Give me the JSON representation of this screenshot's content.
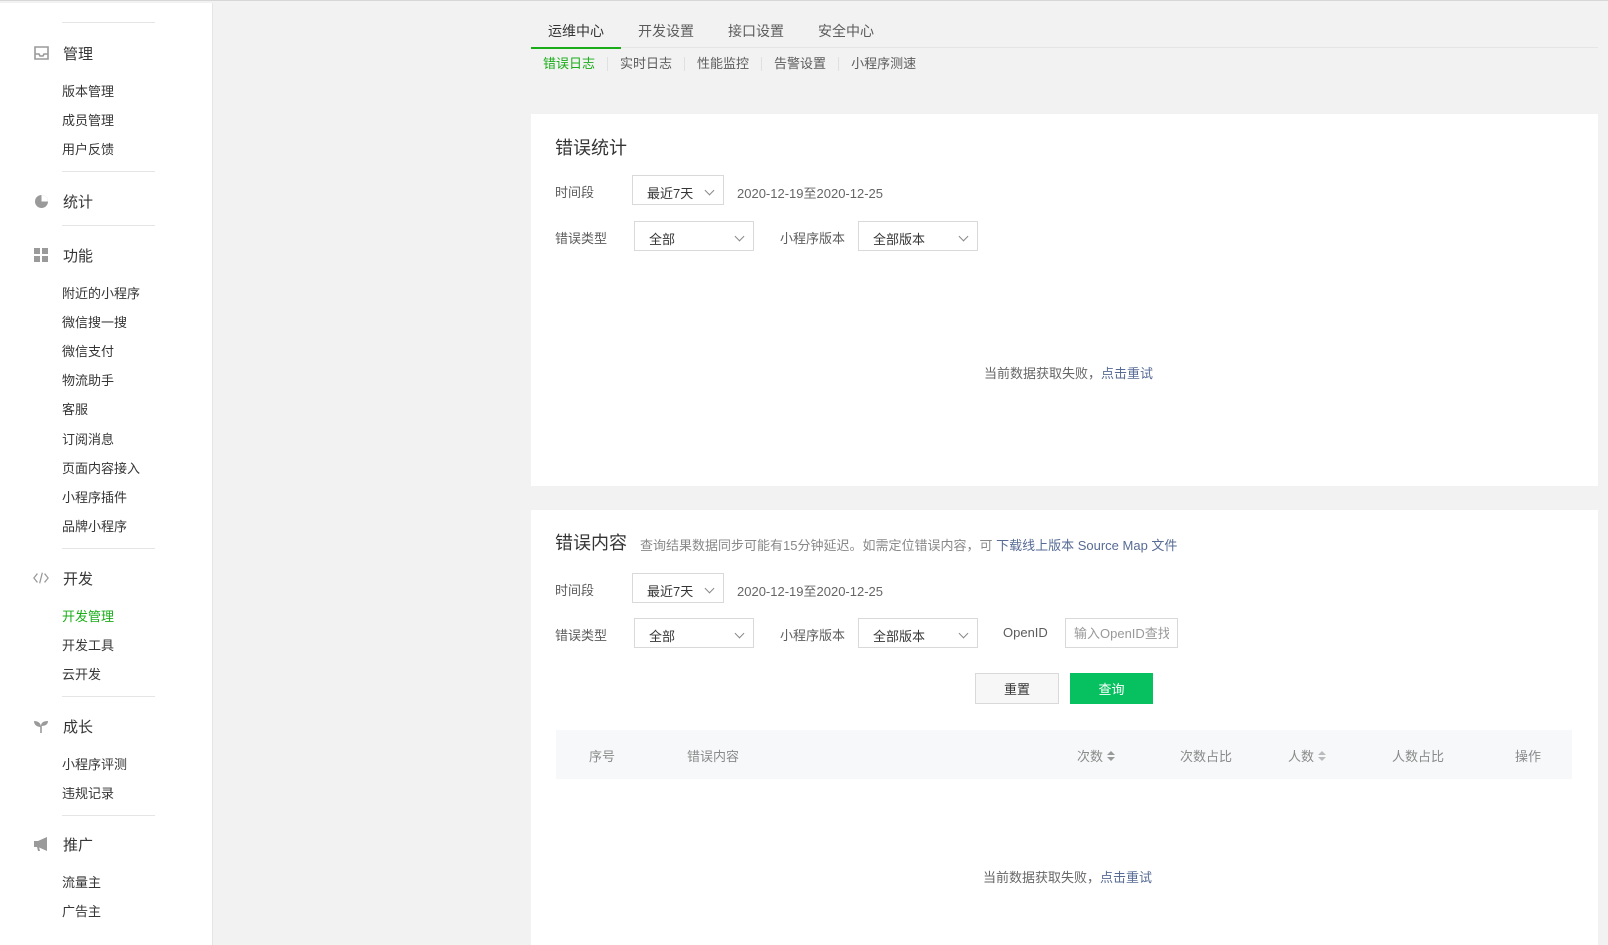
{
  "sidebar": {
    "groups": [
      {
        "label": "管理",
        "icon": "inbox-icon",
        "items": [
          "版本管理",
          "成员管理",
          "用户反馈"
        ]
      },
      {
        "label": "统计",
        "icon": "pie-chart-icon",
        "items": []
      },
      {
        "label": "功能",
        "icon": "grid-icon",
        "items": [
          "附近的小程序",
          "微信搜一搜",
          "微信支付",
          "物流助手",
          "客服",
          "订阅消息",
          "页面内容接入",
          "小程序插件",
          "品牌小程序"
        ]
      },
      {
        "label": "开发",
        "icon": "code-icon",
        "items": [
          "开发管理",
          "开发工具",
          "云开发"
        ]
      },
      {
        "label": "成长",
        "icon": "sprout-icon",
        "items": [
          "小程序评测",
          "违规记录"
        ]
      },
      {
        "label": "推广",
        "icon": "megaphone-icon",
        "items": [
          "流量主",
          "广告主"
        ]
      }
    ],
    "active_item": "开发管理"
  },
  "tabs": [
    "运维中心",
    "开发设置",
    "接口设置",
    "安全中心"
  ],
  "active_tab": "运维中心",
  "subtabs": [
    "错误日志",
    "实时日志",
    "性能监控",
    "告警设置",
    "小程序测速"
  ],
  "active_subtab": "错误日志",
  "stats_card": {
    "title": "错误统计",
    "period_label": "时间段",
    "period_value": "最近7天",
    "date_range": "2020-12-19至2020-12-25",
    "type_label": "错误类型",
    "type_value": "全部",
    "version_label": "小程序版本",
    "version_value": "全部版本",
    "fail_text": "当前数据获取失败，",
    "retry_text": "点击重试"
  },
  "content_card": {
    "title": "错误内容",
    "hint_text": "查询结果数据同步可能有15分钟延迟。如需定位错误内容，可",
    "hint_link": "下载线上版本 Source Map 文件",
    "period_label": "时间段",
    "period_value": "最近7天",
    "date_range": "2020-12-19至2020-12-25",
    "type_label": "错误类型",
    "type_value": "全部",
    "version_label": "小程序版本",
    "version_value": "全部版本",
    "openid_label": "OpenID",
    "openid_placeholder": "输入OpenID查找",
    "reset_label": "重置",
    "query_label": "查询",
    "columns": [
      "序号",
      "错误内容",
      "次数",
      "次数占比",
      "人数",
      "人数占比",
      "操作"
    ],
    "fail_text": "当前数据获取失败，",
    "retry_text": "点击重试"
  },
  "colors": {
    "accent": "#1aad19",
    "primary_button": "#07c160",
    "link": "#576b95"
  }
}
